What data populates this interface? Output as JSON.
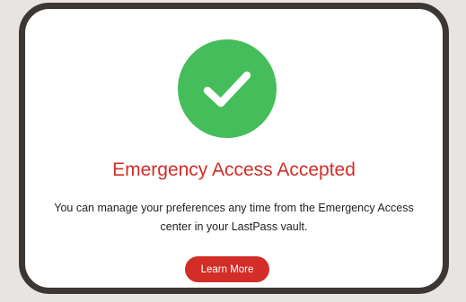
{
  "dialog": {
    "icon": "check-circle-icon",
    "title": "Emergency Access Accepted",
    "message": "You can manage your preferences any time from the Emergency Access center in your LastPass vault.",
    "button_label": "Learn More"
  },
  "colors": {
    "success_green": "#44bd5a",
    "brand_red": "#d32d27",
    "border": "#3d3734",
    "background": "#e8e4e1"
  }
}
